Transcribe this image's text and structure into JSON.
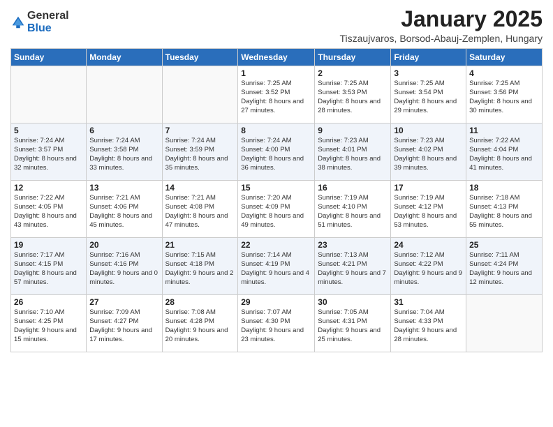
{
  "logo": {
    "general": "General",
    "blue": "Blue"
  },
  "title": "January 2025",
  "subtitle": "Tiszaujvaros, Borsod-Abauj-Zemplen, Hungary",
  "weekdays": [
    "Sunday",
    "Monday",
    "Tuesday",
    "Wednesday",
    "Thursday",
    "Friday",
    "Saturday"
  ],
  "weeks": [
    [
      {
        "day": "",
        "info": ""
      },
      {
        "day": "",
        "info": ""
      },
      {
        "day": "",
        "info": ""
      },
      {
        "day": "1",
        "info": "Sunrise: 7:25 AM\nSunset: 3:52 PM\nDaylight: 8 hours and 27 minutes."
      },
      {
        "day": "2",
        "info": "Sunrise: 7:25 AM\nSunset: 3:53 PM\nDaylight: 8 hours and 28 minutes."
      },
      {
        "day": "3",
        "info": "Sunrise: 7:25 AM\nSunset: 3:54 PM\nDaylight: 8 hours and 29 minutes."
      },
      {
        "day": "4",
        "info": "Sunrise: 7:25 AM\nSunset: 3:56 PM\nDaylight: 8 hours and 30 minutes."
      }
    ],
    [
      {
        "day": "5",
        "info": "Sunrise: 7:24 AM\nSunset: 3:57 PM\nDaylight: 8 hours and 32 minutes."
      },
      {
        "day": "6",
        "info": "Sunrise: 7:24 AM\nSunset: 3:58 PM\nDaylight: 8 hours and 33 minutes."
      },
      {
        "day": "7",
        "info": "Sunrise: 7:24 AM\nSunset: 3:59 PM\nDaylight: 8 hours and 35 minutes."
      },
      {
        "day": "8",
        "info": "Sunrise: 7:24 AM\nSunset: 4:00 PM\nDaylight: 8 hours and 36 minutes."
      },
      {
        "day": "9",
        "info": "Sunrise: 7:23 AM\nSunset: 4:01 PM\nDaylight: 8 hours and 38 minutes."
      },
      {
        "day": "10",
        "info": "Sunrise: 7:23 AM\nSunset: 4:02 PM\nDaylight: 8 hours and 39 minutes."
      },
      {
        "day": "11",
        "info": "Sunrise: 7:22 AM\nSunset: 4:04 PM\nDaylight: 8 hours and 41 minutes."
      }
    ],
    [
      {
        "day": "12",
        "info": "Sunrise: 7:22 AM\nSunset: 4:05 PM\nDaylight: 8 hours and 43 minutes."
      },
      {
        "day": "13",
        "info": "Sunrise: 7:21 AM\nSunset: 4:06 PM\nDaylight: 8 hours and 45 minutes."
      },
      {
        "day": "14",
        "info": "Sunrise: 7:21 AM\nSunset: 4:08 PM\nDaylight: 8 hours and 47 minutes."
      },
      {
        "day": "15",
        "info": "Sunrise: 7:20 AM\nSunset: 4:09 PM\nDaylight: 8 hours and 49 minutes."
      },
      {
        "day": "16",
        "info": "Sunrise: 7:19 AM\nSunset: 4:10 PM\nDaylight: 8 hours and 51 minutes."
      },
      {
        "day": "17",
        "info": "Sunrise: 7:19 AM\nSunset: 4:12 PM\nDaylight: 8 hours and 53 minutes."
      },
      {
        "day": "18",
        "info": "Sunrise: 7:18 AM\nSunset: 4:13 PM\nDaylight: 8 hours and 55 minutes."
      }
    ],
    [
      {
        "day": "19",
        "info": "Sunrise: 7:17 AM\nSunset: 4:15 PM\nDaylight: 8 hours and 57 minutes."
      },
      {
        "day": "20",
        "info": "Sunrise: 7:16 AM\nSunset: 4:16 PM\nDaylight: 9 hours and 0 minutes."
      },
      {
        "day": "21",
        "info": "Sunrise: 7:15 AM\nSunset: 4:18 PM\nDaylight: 9 hours and 2 minutes."
      },
      {
        "day": "22",
        "info": "Sunrise: 7:14 AM\nSunset: 4:19 PM\nDaylight: 9 hours and 4 minutes."
      },
      {
        "day": "23",
        "info": "Sunrise: 7:13 AM\nSunset: 4:21 PM\nDaylight: 9 hours and 7 minutes."
      },
      {
        "day": "24",
        "info": "Sunrise: 7:12 AM\nSunset: 4:22 PM\nDaylight: 9 hours and 9 minutes."
      },
      {
        "day": "25",
        "info": "Sunrise: 7:11 AM\nSunset: 4:24 PM\nDaylight: 9 hours and 12 minutes."
      }
    ],
    [
      {
        "day": "26",
        "info": "Sunrise: 7:10 AM\nSunset: 4:25 PM\nDaylight: 9 hours and 15 minutes."
      },
      {
        "day": "27",
        "info": "Sunrise: 7:09 AM\nSunset: 4:27 PM\nDaylight: 9 hours and 17 minutes."
      },
      {
        "day": "28",
        "info": "Sunrise: 7:08 AM\nSunset: 4:28 PM\nDaylight: 9 hours and 20 minutes."
      },
      {
        "day": "29",
        "info": "Sunrise: 7:07 AM\nSunset: 4:30 PM\nDaylight: 9 hours and 23 minutes."
      },
      {
        "day": "30",
        "info": "Sunrise: 7:05 AM\nSunset: 4:31 PM\nDaylight: 9 hours and 25 minutes."
      },
      {
        "day": "31",
        "info": "Sunrise: 7:04 AM\nSunset: 4:33 PM\nDaylight: 9 hours and 28 minutes."
      },
      {
        "day": "",
        "info": ""
      }
    ]
  ]
}
